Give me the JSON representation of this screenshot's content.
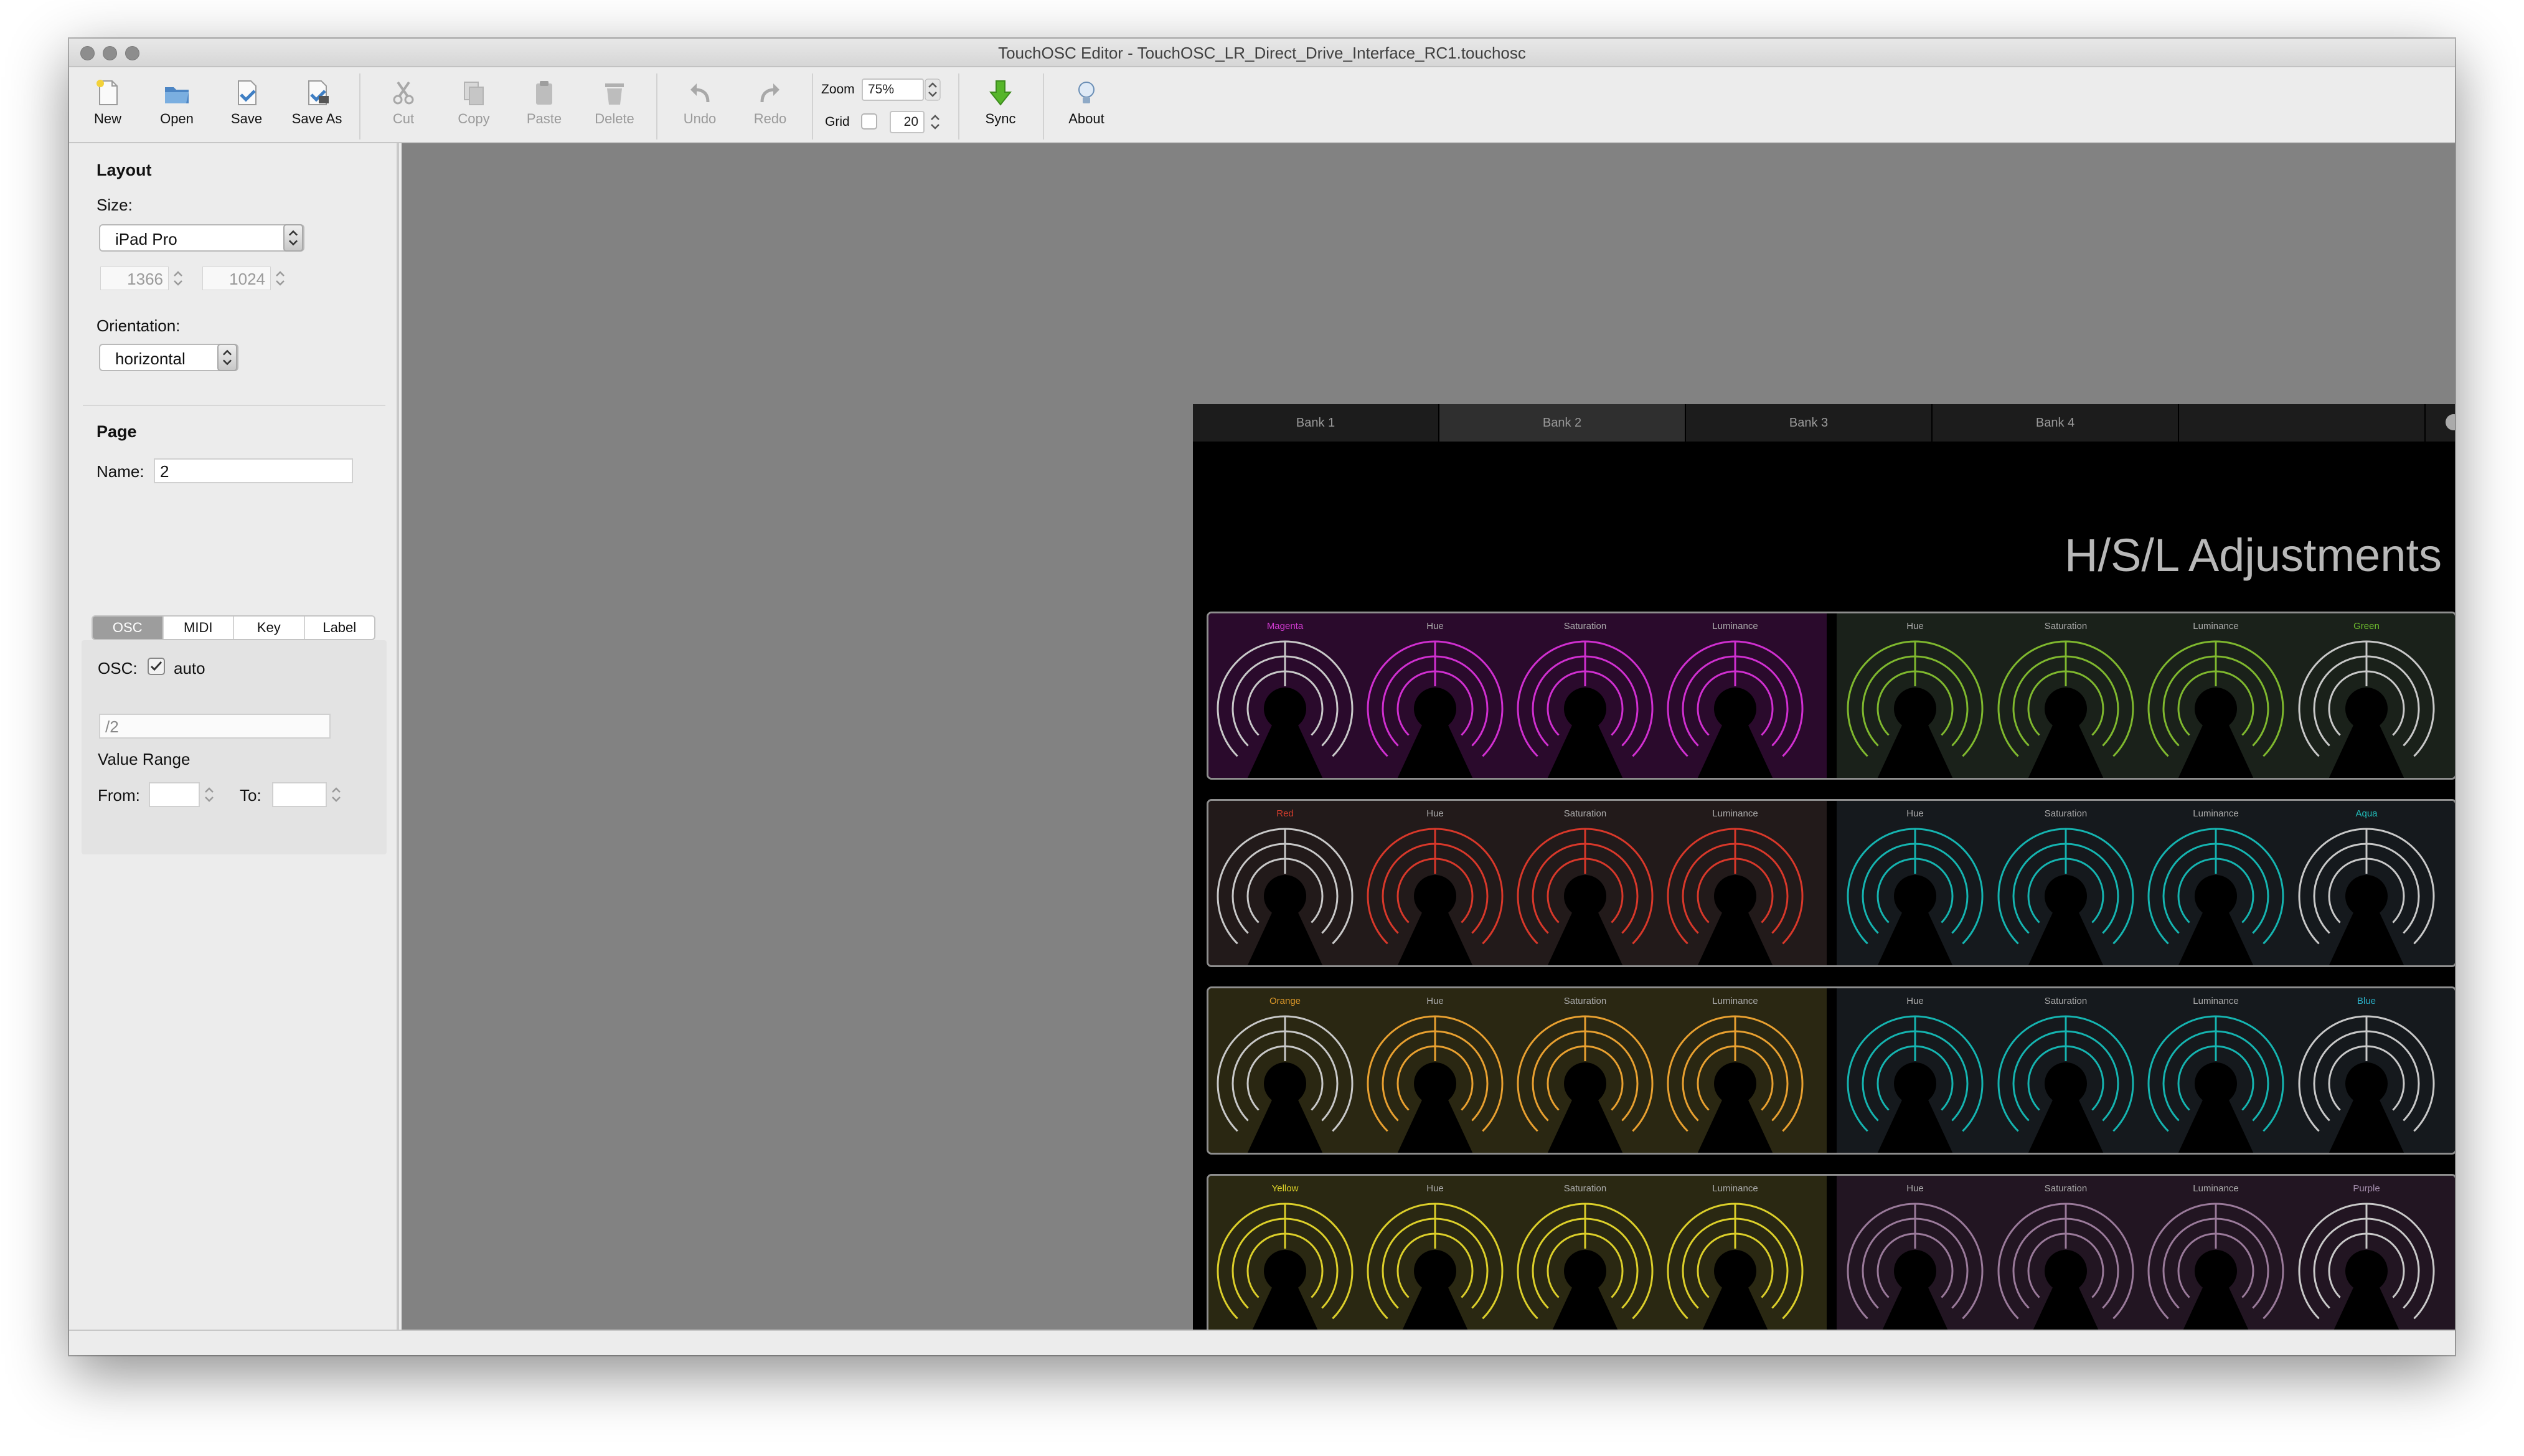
{
  "window": {
    "title": "TouchOSC Editor - TouchOSC_LR_Direct_Drive_Interface_RC1.touchosc"
  },
  "toolbar": {
    "new": "New",
    "open": "Open",
    "save": "Save",
    "save_as": "Save As",
    "cut": "Cut",
    "copy": "Copy",
    "paste": "Paste",
    "delete": "Delete",
    "undo": "Undo",
    "redo": "Redo",
    "zoom_label": "Zoom",
    "zoom_value": "75%",
    "grid_label": "Grid",
    "grid_value": "20",
    "sync": "Sync",
    "about": "About"
  },
  "sidebar": {
    "layout_heading": "Layout",
    "size_label": "Size:",
    "size_value": "iPad Pro",
    "width": "1366",
    "height": "1024",
    "orientation_label": "Orientation:",
    "orientation_value": "horizontal",
    "page_heading": "Page",
    "name_label": "Name:",
    "name_value": "2",
    "tabs": [
      "OSC",
      "MIDI",
      "Key",
      "Label"
    ],
    "osc_label": "OSC:",
    "osc_auto": "auto",
    "osc_address": "/2",
    "value_range": "Value Range",
    "from_label": "From:",
    "to_label": "To:"
  },
  "device": {
    "tabs": [
      "Bank 1",
      "Bank 2",
      "Bank 3",
      "Bank 4",
      ""
    ],
    "title": "H/S/L Adjustments",
    "rows": [
      {
        "left_bg": "#2a0a2c",
        "right_bg": "#1a211a",
        "knobs": [
          {
            "label": "Magenta",
            "color": "#c8c8c8",
            "label_color": "#d23bd2"
          },
          {
            "label": "Hue",
            "color": "#d02fd0",
            "label_color": "#aaaaaa"
          },
          {
            "label": "Saturation",
            "color": "#d02fd0",
            "label_color": "#aaaaaa"
          },
          {
            "label": "Luminance",
            "color": "#d02fd0",
            "label_color": "#aaaaaa"
          },
          {
            "label": "Hue",
            "color": "#7fb82e",
            "label_color": "#aaaaaa"
          },
          {
            "label": "Saturation",
            "color": "#7fb82e",
            "label_color": "#aaaaaa"
          },
          {
            "label": "Luminance",
            "color": "#7fb82e",
            "label_color": "#aaaaaa"
          },
          {
            "label": "Green",
            "color": "#c8c8c8",
            "label_color": "#6fbf2e"
          }
        ]
      },
      {
        "left_bg": "#221a1a",
        "right_bg": "#15191d",
        "knobs": [
          {
            "label": "Red",
            "color": "#c8c8c8",
            "label_color": "#d23c2c"
          },
          {
            "label": "Hue",
            "color": "#d8382a",
            "label_color": "#aaaaaa"
          },
          {
            "label": "Saturation",
            "color": "#d8382a",
            "label_color": "#aaaaaa"
          },
          {
            "label": "Luminance",
            "color": "#d8382a",
            "label_color": "#aaaaaa"
          },
          {
            "label": "Hue",
            "color": "#15b4b0",
            "label_color": "#aaaaaa"
          },
          {
            "label": "Saturation",
            "color": "#15b4b0",
            "label_color": "#aaaaaa"
          },
          {
            "label": "Luminance",
            "color": "#15b4b0",
            "label_color": "#aaaaaa"
          },
          {
            "label": "Aqua",
            "color": "#c8c8c8",
            "label_color": "#22c3c0"
          }
        ]
      },
      {
        "left_bg": "#2a2712",
        "right_bg": "#15191d",
        "knobs": [
          {
            "label": "Orange",
            "color": "#c8c8c8",
            "label_color": "#e09a2a"
          },
          {
            "label": "Hue",
            "color": "#e8a030",
            "label_color": "#aaaaaa"
          },
          {
            "label": "Saturation",
            "color": "#e8a030",
            "label_color": "#aaaaaa"
          },
          {
            "label": "Luminance",
            "color": "#e8a030",
            "label_color": "#aaaaaa"
          },
          {
            "label": "Hue",
            "color": "#15b4b0",
            "label_color": "#aaaaaa"
          },
          {
            "label": "Saturation",
            "color": "#15b4b0",
            "label_color": "#aaaaaa"
          },
          {
            "label": "Luminance",
            "color": "#15b4b0",
            "label_color": "#aaaaaa"
          },
          {
            "label": "Blue",
            "color": "#c8c8c8",
            "label_color": "#2ab0c8"
          }
        ]
      },
      {
        "left_bg": "#2a2812",
        "right_bg": "#221522",
        "knobs": [
          {
            "label": "Yellow",
            "color": "#dccf2a",
            "label_color": "#e0d52a"
          },
          {
            "label": "Hue",
            "color": "#dccf2a",
            "label_color": "#aaaaaa"
          },
          {
            "label": "Saturation",
            "color": "#dccf2a",
            "label_color": "#aaaaaa"
          },
          {
            "label": "Luminance",
            "color": "#dccf2a",
            "label_color": "#aaaaaa"
          },
          {
            "label": "Hue",
            "color": "#9a7a9a",
            "label_color": "#aaaaaa"
          },
          {
            "label": "Saturation",
            "color": "#9a7a9a",
            "label_color": "#aaaaaa"
          },
          {
            "label": "Luminance",
            "color": "#9a7a9a",
            "label_color": "#aaaaaa"
          },
          {
            "label": "Purple",
            "color": "#c8c8c8",
            "label_color": "#a08aa8"
          }
        ]
      }
    ]
  }
}
